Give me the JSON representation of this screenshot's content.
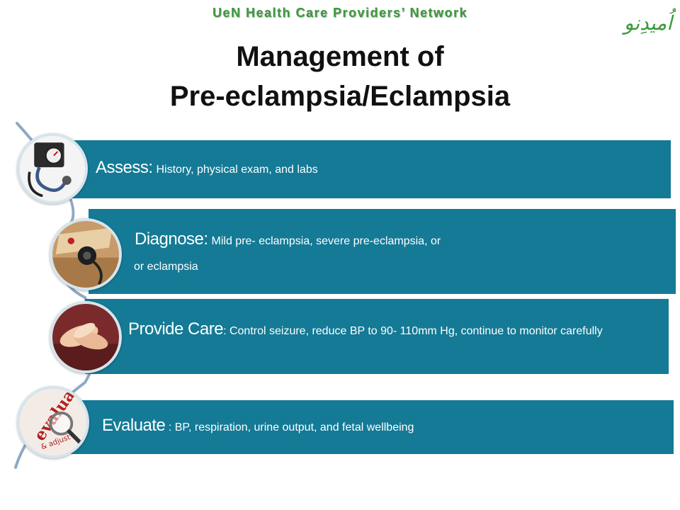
{
  "header": {
    "network": "UeN Health Care Providers’ Network",
    "logo_text": "اُمیدِنو",
    "title_line1": "Management of",
    "title_line2": "Pre-eclampsia/Eclampsia"
  },
  "steps": [
    {
      "heading": "Assess",
      "separator": ":",
      "text": " History, physical exam, and labs",
      "icon": "blood-pressure-cuff-icon"
    },
    {
      "heading": "Diagnose",
      "separator": ":",
      "text": " Mild pre- eclampsia, severe pre-eclampsia, or",
      "text2": "or eclampsia",
      "icon": "stethoscope-icon"
    },
    {
      "heading": "Provide Care",
      "separator": ":",
      "text": " Control seizure, reduce BP to 90- 110mm Hg, continue to monitor carefully",
      "icon": "caring-hands-icon"
    },
    {
      "heading": "Evaluate",
      "separator": " :",
      "text": " BP, respiration, urine output, and fetal wellbeing",
      "icon": "evaluate-magnifier-icon",
      "icon_label1": "evaluate",
      "icon_label2": "& adjust"
    }
  ],
  "colors": {
    "bar": "#147a96",
    "accent_green": "#3a9a3a",
    "connector": "#8fa9c4"
  }
}
